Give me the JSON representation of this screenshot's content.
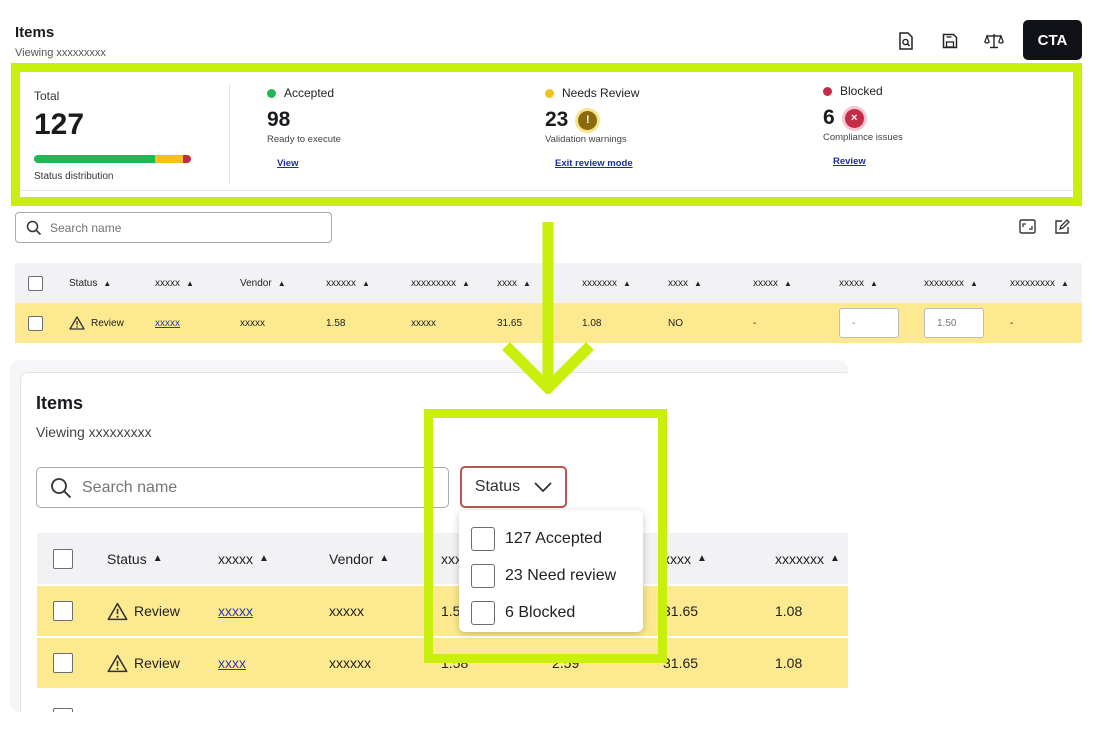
{
  "header": {
    "title": "Items",
    "subtitle": "Viewing xxxxxxxxx",
    "icons": [
      "search-document-icon",
      "save-icon",
      "scale-icon"
    ],
    "cta_label": "CTA"
  },
  "summary": {
    "total_label": "Total",
    "total_value": "127",
    "distribution": [
      {
        "status": "accepted",
        "fraction": 0.77,
        "color": "#1db954"
      },
      {
        "status": "needs_review",
        "fraction": 0.18,
        "color": "#f4c020"
      },
      {
        "status": "blocked",
        "fraction": 0.05,
        "color": "#c42c45"
      }
    ],
    "distribution_label": "Status distribution",
    "accepted": {
      "label": "Accepted",
      "value": "98",
      "desc": "Ready to execute",
      "link": "View",
      "color": "#1db954"
    },
    "needs_review": {
      "label": "Needs Review",
      "value": "23",
      "desc": "Validation warnings",
      "link": "Exit review mode",
      "color": "#f4c020",
      "badge": "!"
    },
    "blocked": {
      "label": "Blocked",
      "value": "6",
      "desc": "Compliance issues",
      "link": "Review",
      "color": "#c42c45",
      "badge": "×"
    }
  },
  "top_search": {
    "placeholder": "Search name"
  },
  "top_table": {
    "headers": [
      "Status",
      "xxxxx",
      "Vendor",
      "xxxxxx",
      "xxxxxxxxx",
      "xxxx",
      "xxxxxxx",
      "xxxx",
      "xxxxx",
      "xxxxx",
      "xxxxxxxx",
      "xxxxxxxxx"
    ],
    "row": {
      "status": "Review",
      "c1": "xxxxx",
      "c2": "xxxxx",
      "c3": "1.58",
      "c4": "xxxxx",
      "c5": "31.65",
      "c6": "1.08",
      "c7": "NO",
      "c8": "-",
      "input1_value": "-",
      "input2_value": "1.50",
      "c11": "-"
    }
  },
  "zoom": {
    "title": "Items",
    "subtitle": "Viewing xxxxxxxxx",
    "search_placeholder": "Search name",
    "status_button": "Status",
    "headers": [
      "Status",
      "xxxxx",
      "Vendor",
      "xxx",
      "",
      "xxxx",
      "xxxxxxx"
    ],
    "rows": [
      {
        "status": "Review",
        "c1": "xxxxx",
        "c2": "xxxxx",
        "c3": "1.5",
        "c4": "",
        "c5": "31.65",
        "c6": "1.08"
      },
      {
        "status": "Review",
        "c1": "xxxx",
        "c2": "xxxxxx",
        "c3": "1.58",
        "c4": "2.59",
        "c5": "31.65",
        "c6": "1.08"
      }
    ],
    "dropdown": [
      {
        "label": "127 Accepted"
      },
      {
        "label": "23 Need review"
      },
      {
        "label": "6 Blocked"
      }
    ]
  },
  "colors": {
    "highlight": "#c8f00c",
    "review_row": "#fde98f",
    "cta_bg": "#111118",
    "link": "#1d2f9e"
  }
}
